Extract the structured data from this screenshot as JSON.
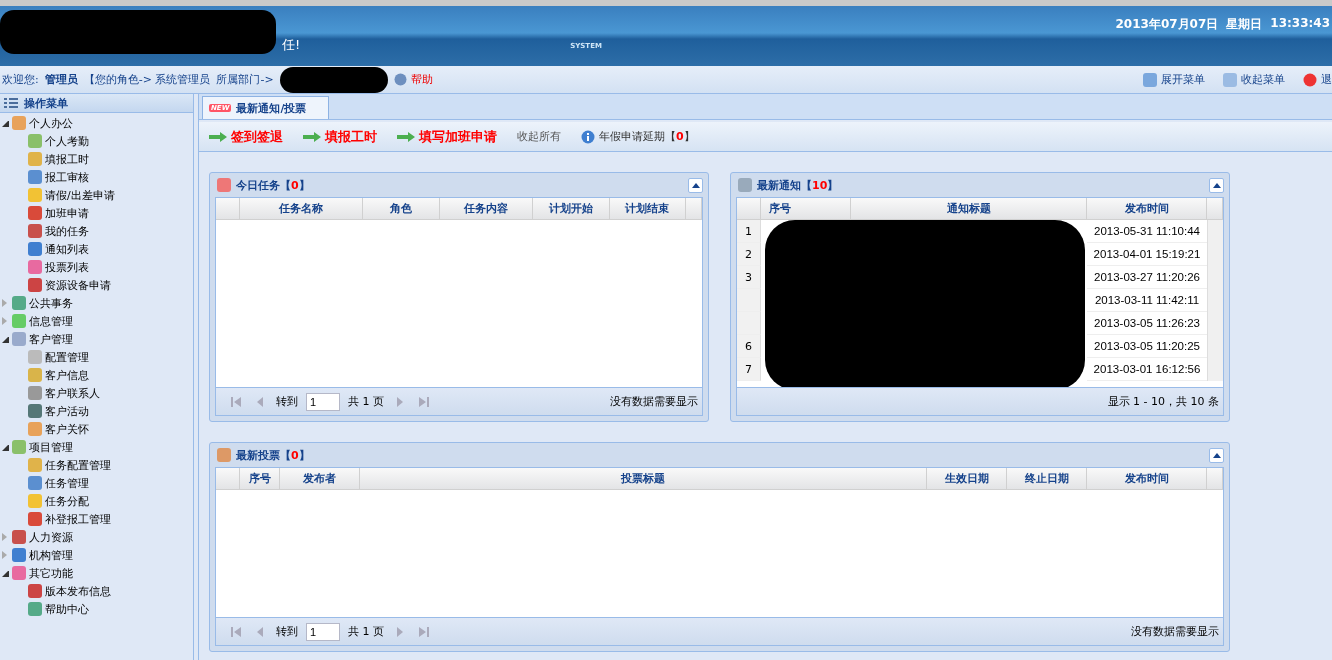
{
  "header": {
    "greeting_tail": "任!",
    "system_word": "SYSTEM",
    "date": "2013年07月07日",
    "weekday": "星期日",
    "time": "13:33:43"
  },
  "user_bar": {
    "welcome_label": "欢迎您:",
    "user": "管理员",
    "role": "【您的角色-> 系统管理员",
    "department_label": "所属部门->",
    "help": "帮助",
    "actions": [
      {
        "kind": "expand",
        "label": "展开菜单"
      },
      {
        "kind": "collapse",
        "label": "收起菜单"
      },
      {
        "kind": "exit",
        "label": "退"
      }
    ]
  },
  "sidebar": {
    "title": "操作菜单",
    "items": [
      {
        "label": "个人办公",
        "expanded": true,
        "children": [
          {
            "label": "个人考勤"
          },
          {
            "label": "填报工时"
          },
          {
            "label": "报工审核"
          },
          {
            "label": "请假/出差申请"
          },
          {
            "label": "加班申请"
          },
          {
            "label": "我的任务"
          },
          {
            "label": "通知列表"
          },
          {
            "label": "投票列表"
          },
          {
            "label": "资源设备申请"
          }
        ]
      },
      {
        "label": "公共事务",
        "expanded": false
      },
      {
        "label": "信息管理",
        "expanded": false
      },
      {
        "label": "客户管理",
        "expanded": true,
        "children": [
          {
            "label": "配置管理"
          },
          {
            "label": "客户信息"
          },
          {
            "label": "客户联系人"
          },
          {
            "label": "客户活动"
          },
          {
            "label": "客户关怀"
          }
        ]
      },
      {
        "label": "项目管理",
        "expanded": true,
        "children": [
          {
            "label": "任务配置管理"
          },
          {
            "label": "任务管理"
          },
          {
            "label": "任务分配"
          },
          {
            "label": "补登报工管理"
          }
        ]
      },
      {
        "label": "人力资源",
        "expanded": false
      },
      {
        "label": "机构管理",
        "expanded": false
      },
      {
        "label": "其它功能",
        "expanded": true,
        "children": [
          {
            "label": "版本发布信息"
          },
          {
            "label": "帮助中心"
          }
        ]
      }
    ]
  },
  "tab": {
    "badge": "NEW",
    "label": "最新通知/投票",
    "selected": true
  },
  "toolbar": {
    "actions": [
      {
        "kind": "link",
        "label": "签到签退"
      },
      {
        "kind": "link",
        "label": "填报工时"
      },
      {
        "kind": "link",
        "label": "填写加班申请"
      },
      {
        "kind": "plain",
        "label": "收起所有"
      }
    ],
    "leave": {
      "before": "年假申请延期【",
      "count": "0",
      "after": "】"
    }
  },
  "tasks_panel": {
    "before": "今日任务【",
    "count": "0",
    "after": "】",
    "columns": [
      "任务名称",
      "角色",
      "任务内容",
      "计划开始",
      "计划结束"
    ],
    "pager": {
      "goto": "转到",
      "page": "1",
      "total_label": "共",
      "total": "1",
      "page_unit": "页",
      "status": "没有数据需要显示"
    }
  },
  "notices_panel": {
    "before": "最新通知【",
    "count": "10",
    "after": "】",
    "columns": [
      "序号",
      "通知标题",
      "发布时间"
    ],
    "rows": [
      {
        "row_number": "1",
        "time": "2013-05-31 11:10:44"
      },
      {
        "row_number": "2",
        "time": "2013-04-01 15:19:21"
      },
      {
        "row_number": "3",
        "time": "2013-03-27 11:20:26"
      },
      {
        "time": "2013-03-11 11:42:11"
      },
      {
        "time": "2013-03-05 11:26:23"
      },
      {
        "row_number": "6",
        "time": "2013-03-05 11:20:25"
      },
      {
        "row_number": "7",
        "time": "2013-03-01 16:12:56"
      }
    ],
    "status": "显示 1 - 10，共 10 条"
  },
  "votes_panel": {
    "before": "最新投票【",
    "count": "0",
    "after": "】",
    "columns": [
      "序号",
      "发布者",
      "投票标题",
      "生效日期",
      "终止日期",
      "发布时间"
    ],
    "pager": {
      "goto": "转到",
      "page": "1",
      "total_label": "共",
      "total": "1",
      "page_unit": "页",
      "status": "没有数据需要显示"
    }
  }
}
